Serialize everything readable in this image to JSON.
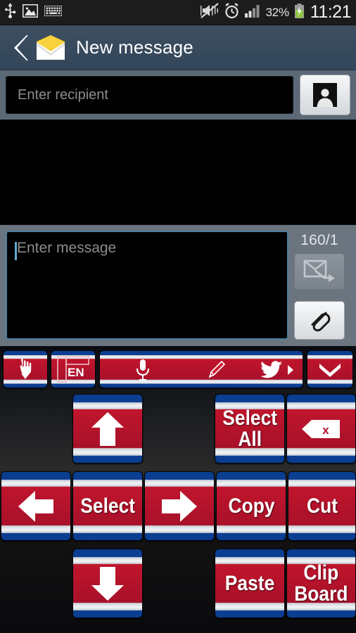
{
  "statusbar": {
    "left_icons": [
      "usb-icon",
      "image-icon",
      "keyboard-icon"
    ],
    "right_icons": [
      "mute-vibrate-off-icon",
      "alarm-icon",
      "signal-icon"
    ],
    "battery_percent": "32%",
    "battery_state": "charging",
    "clock": "11:21"
  },
  "actionbar": {
    "back_label": "back",
    "app_icon": "envelope-icon",
    "title": "New message"
  },
  "recipient": {
    "placeholder": "Enter recipient",
    "value": "",
    "contacts_button": "contacts-icon"
  },
  "compose": {
    "placeholder": "Enter message",
    "value": "",
    "counter": "160/1",
    "send_button": "send-icon",
    "attach_button": "paperclip-icon"
  },
  "keyboard": {
    "toolbar": [
      {
        "name": "hand-down-icon",
        "label": ""
      },
      {
        "name": "language-en-icon",
        "label": "EN"
      },
      {
        "name": "input-modes-bar",
        "label": ""
      },
      {
        "name": "hide-keyboard-icon",
        "label": ""
      }
    ],
    "toolbar_inner_icons": [
      "microphone-icon",
      "pencil-icon",
      "twitter-icon",
      "arrow-right-icon"
    ],
    "rows": [
      [
        {
          "name": "key-arrow-up",
          "label": "",
          "icon": "arrow-up-icon"
        },
        {
          "name": "key-select-all",
          "label": "Select\nAll",
          "icon": ""
        },
        {
          "name": "key-backspace",
          "label": "",
          "icon": "backspace-icon"
        }
      ],
      [
        {
          "name": "key-arrow-left",
          "label": "",
          "icon": "arrow-left-icon"
        },
        {
          "name": "key-select",
          "label": "Select",
          "icon": ""
        },
        {
          "name": "key-arrow-right",
          "label": "",
          "icon": "arrow-right-icon"
        },
        {
          "name": "key-copy",
          "label": "Copy",
          "icon": ""
        },
        {
          "name": "key-cut",
          "label": "Cut",
          "icon": ""
        }
      ],
      [
        {
          "name": "key-arrow-down",
          "label": "",
          "icon": "arrow-down-icon"
        },
        {
          "name": "key-paste",
          "label": "Paste",
          "icon": ""
        },
        {
          "name": "key-clipboard",
          "label": "Clip\nBoard",
          "icon": ""
        }
      ]
    ],
    "labels": {
      "select_all_line1": "Select",
      "select_all_line2": "All",
      "select": "Select",
      "copy": "Copy",
      "cut": "Cut",
      "paste": "Paste",
      "clipboard_line1": "Clip",
      "clipboard_line2": "Board",
      "lang": "EN"
    }
  },
  "colors": {
    "key_red": "#b4122c",
    "key_blue": "#0b3d91",
    "actionbar": "#36495c",
    "panel": "#6b7580",
    "accent_focus": "#4c7f9c"
  }
}
